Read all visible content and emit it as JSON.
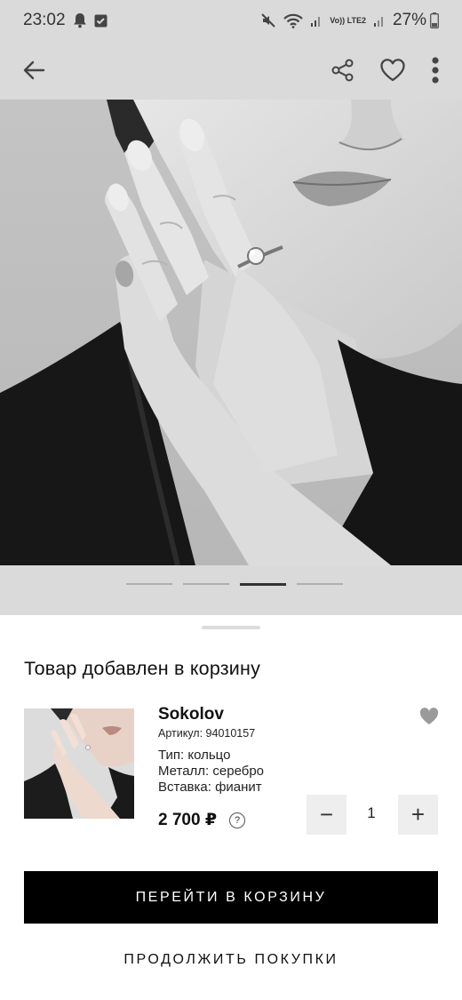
{
  "status_bar": {
    "time": "23:02",
    "network": "Vo)) LTE2",
    "battery": "27%"
  },
  "app_bar": {
    "back_icon": "arrow-left-icon",
    "share_icon": "share-icon",
    "favorite_icon": "heart-outline-icon",
    "more_icon": "more-vertical-icon"
  },
  "carousel": {
    "total": 4,
    "active_index": 2
  },
  "sheet": {
    "title": "Товар добавлен в корзину",
    "product": {
      "brand": "Sokolov",
      "sku": "Артикул: 94010157",
      "type": "Тип: кольцо",
      "metal": "Металл: серебро",
      "insert": "Вставка: фианит",
      "price": "2 700 ₽",
      "info_glyph": "?",
      "quantity": "1",
      "minus": "−",
      "plus": "+"
    },
    "go_to_cart": "ПЕРЕЙТИ В КОРЗИНУ",
    "continue_shopping": "ПРОДОЛЖИТЬ ПОКУПКИ"
  },
  "colors": {
    "bar_bg": "#dadada",
    "primary_button": "#000000",
    "stepper_bg": "#eeeeee"
  }
}
